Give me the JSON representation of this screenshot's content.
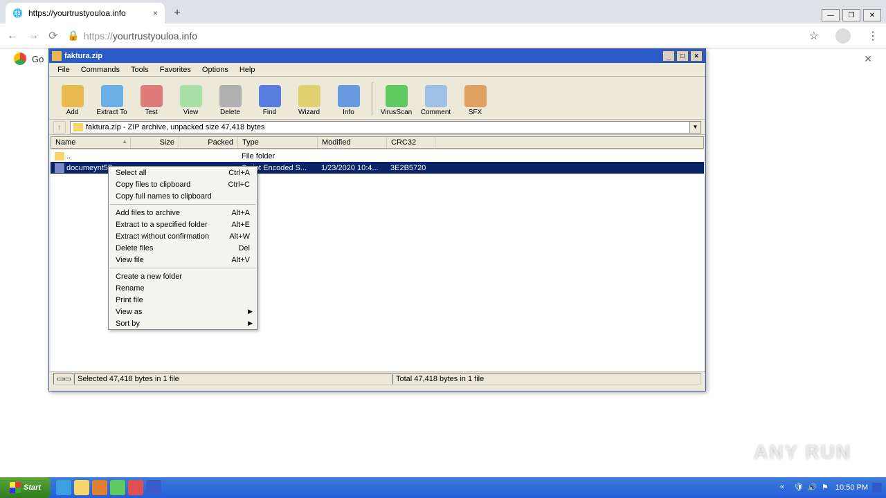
{
  "browser": {
    "tab_title": "https://yourtrustyouloa.info",
    "url_proto": "https://",
    "url_host": "yourtrustyouloa.info",
    "bookmark_label": "Go"
  },
  "winrar": {
    "title": "faktura.zip",
    "menu": [
      "File",
      "Commands",
      "Tools",
      "Favorites",
      "Options",
      "Help"
    ],
    "toolbar": [
      {
        "label": "Add",
        "color": "#e9b94e"
      },
      {
        "label": "Extract To",
        "color": "#6ab0e6"
      },
      {
        "label": "Test",
        "color": "#e07b7b"
      },
      {
        "label": "View",
        "color": "#a8e0a8"
      },
      {
        "label": "Delete",
        "color": "#b0b0b0"
      },
      {
        "label": "Find",
        "color": "#5a7de0"
      },
      {
        "label": "Wizard",
        "color": "#e0d070"
      },
      {
        "label": "Info",
        "color": "#6a9be0"
      },
      {
        "label": "VirusScan",
        "color": "#5ec95e"
      },
      {
        "label": "Comment",
        "color": "#9ec0e6"
      },
      {
        "label": "SFX",
        "color": "#e0a060"
      }
    ],
    "path": "faktura.zip - ZIP archive, unpacked size 47,418 bytes",
    "cols": {
      "name": "Name",
      "size": "Size",
      "packed": "Packed",
      "type": "Type",
      "mod": "Modified",
      "crc": "CRC32"
    },
    "rows": [
      {
        "name": "..",
        "type": "File folder",
        "sel": false,
        "folder": true
      },
      {
        "name": "documeynt57",
        "type": "Script Encoded S...",
        "mod": "1/23/2020 10:4...",
        "crc": "3E2B5720",
        "sel": true,
        "folder": false
      }
    ],
    "status_left": "Selected 47,418 bytes in 1 file",
    "status_right": "Total 47,418 bytes in 1 file"
  },
  "ctx": [
    {
      "label": "Select all",
      "sc": "Ctrl+A"
    },
    {
      "label": "Copy files to clipboard",
      "sc": "Ctrl+C"
    },
    {
      "label": "Copy full names to clipboard"
    },
    {
      "hr": true
    },
    {
      "label": "Add files to archive",
      "sc": "Alt+A"
    },
    {
      "label": "Extract to a specified folder",
      "sc": "Alt+E"
    },
    {
      "label": "Extract without confirmation",
      "sc": "Alt+W"
    },
    {
      "label": "Delete files",
      "sc": "Del"
    },
    {
      "label": "View file",
      "sc": "Alt+V"
    },
    {
      "hr": true
    },
    {
      "label": "Create a new folder"
    },
    {
      "label": "Rename"
    },
    {
      "label": "Print file"
    },
    {
      "label": "View as",
      "sub": true
    },
    {
      "label": "Sort by",
      "sub": true
    }
  ],
  "taskbar": {
    "start": "Start",
    "icons": [
      "#3aa0e0",
      "#f7d56a",
      "#e08030",
      "#5ec95e",
      "#e05050",
      "#3a5bc9"
    ],
    "clock": "10:50 PM"
  },
  "watermark": "ANY    RUN"
}
